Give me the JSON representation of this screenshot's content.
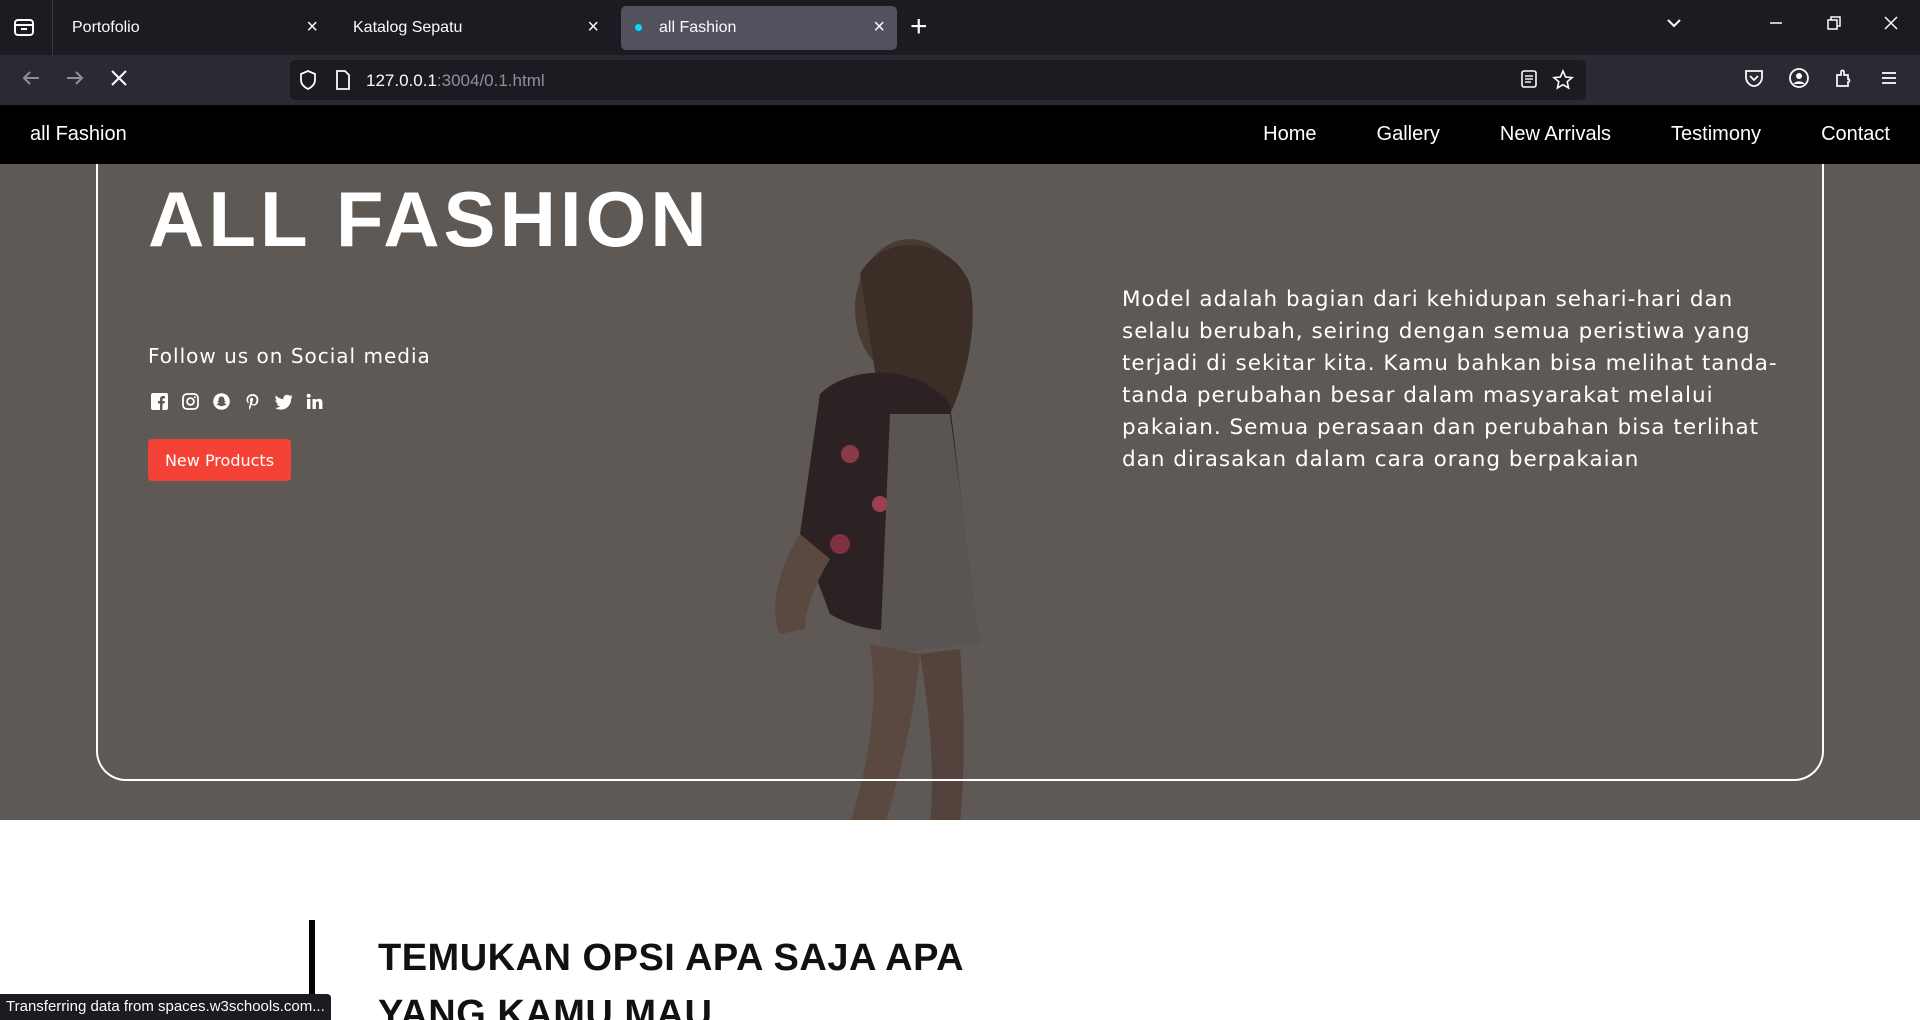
{
  "browser": {
    "tabs": [
      {
        "title": "Portofolio"
      },
      {
        "title": "Katalog Sepatu"
      },
      {
        "title": "all Fashion"
      }
    ],
    "url_host": "127.0.0.1",
    "url_rest": ":3004/0.1.html",
    "status_text": "Transferring data from spaces.w3schools.com..."
  },
  "site": {
    "brand": "all Fashion",
    "menu": [
      "Home",
      "Gallery",
      "New Arrivals",
      "Testimony",
      "Contact"
    ]
  },
  "hero": {
    "title": "ALL FASHION",
    "follow_text": "Follow us on Social media",
    "social_icons": [
      "facebook-icon",
      "instagram-icon",
      "snapchat-icon",
      "pinterest-icon",
      "twitter-icon",
      "linkedin-icon"
    ],
    "button_label": "New Products",
    "description": "Model adalah bagian dari kehidupan sehari-hari dan selalu berubah, seiring dengan semua peristiwa yang terjadi di sekitar kita. Kamu bahkan bisa melihat tanda-tanda perubahan besar dalam masyarakat melalui pakaian. Semua perasaan dan perubahan bisa terlihat dan dirasakan dalam cara orang berpakaian"
  },
  "section": {
    "title": "TEMUKAN OPSI APA SAJA APA YANG KAMU MAU"
  },
  "colors": {
    "button": "#f44336",
    "nav_bg": "#000000",
    "hero_overlay": "#5e5955"
  }
}
